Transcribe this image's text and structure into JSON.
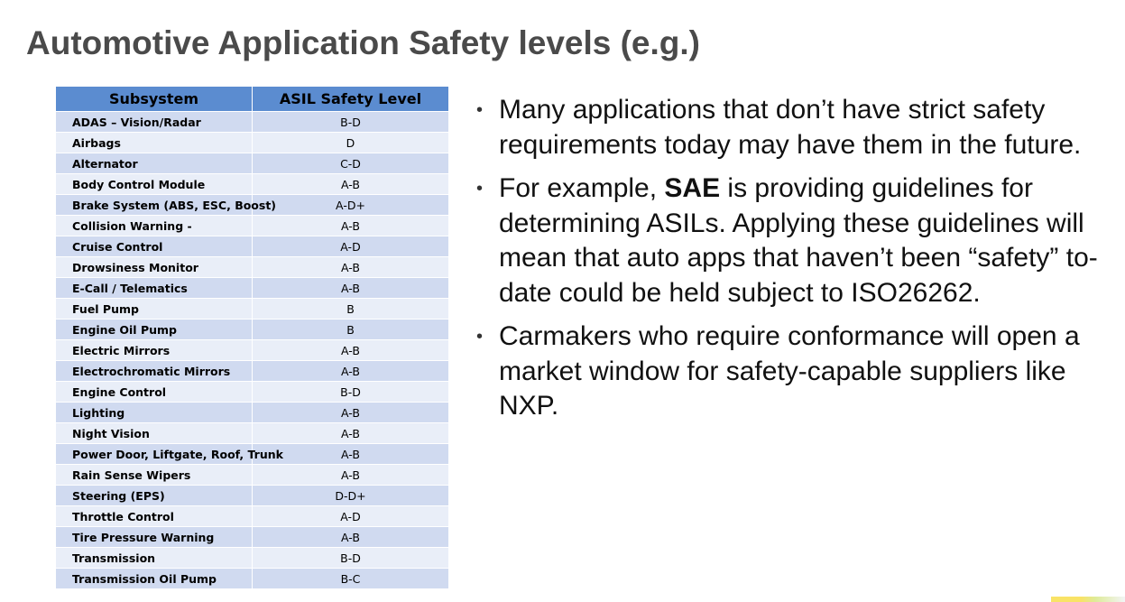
{
  "title": "Automotive Application Safety levels (e.g.)",
  "table": {
    "headers": {
      "subsystem": "Subsystem",
      "level": "ASIL Safety Level"
    },
    "rows": [
      {
        "subsystem": "ADAS – Vision/Radar",
        "level": "B-D"
      },
      {
        "subsystem": "Airbags",
        "level": "D"
      },
      {
        "subsystem": "Alternator",
        "level": "C-D"
      },
      {
        "subsystem": "Body Control Module",
        "level": "A-B"
      },
      {
        "subsystem": "Brake System (ABS, ESC, Boost)",
        "level": "A-D+"
      },
      {
        "subsystem": "Collision Warning -",
        "level": "A-B"
      },
      {
        "subsystem": "Cruise Control",
        "level": "A-D"
      },
      {
        "subsystem": "Drowsiness Monitor",
        "level": "A-B"
      },
      {
        "subsystem": "E-Call / Telematics",
        "level": "A-B"
      },
      {
        "subsystem": "Fuel Pump",
        "level": "B"
      },
      {
        "subsystem": "Engine Oil Pump",
        "level": "B"
      },
      {
        "subsystem": "Electric Mirrors",
        "level": "A-B"
      },
      {
        "subsystem": "Electrochromatic Mirrors",
        "level": "A-B"
      },
      {
        "subsystem": "Engine Control",
        "level": "B-D"
      },
      {
        "subsystem": "Lighting",
        "level": "A-B"
      },
      {
        "subsystem": "Night Vision",
        "level": "A-B"
      },
      {
        "subsystem": "Power Door, Liftgate, Roof, Trunk",
        "level": "A-B"
      },
      {
        "subsystem": "Rain Sense Wipers",
        "level": "A-B"
      },
      {
        "subsystem": "Steering (EPS)",
        "level": "D-D+"
      },
      {
        "subsystem": "Throttle Control",
        "level": "A-D"
      },
      {
        "subsystem": "Tire Pressure Warning",
        "level": "A-B"
      },
      {
        "subsystem": "Transmission",
        "level": "B-D"
      },
      {
        "subsystem": "Transmission Oil Pump",
        "level": "B-C"
      }
    ]
  },
  "bullets": [
    {
      "marker": "•",
      "text": "Many applications that don’t have strict safety requirements today may have them in the future."
    },
    {
      "marker": "•",
      "pre": "For example, ",
      "bold": "SAE",
      "post": " is providing guidelines for determining ASILs.  Applying these guidelines will mean that auto apps that haven’t been “safety” to-date could be held subject to ISO26262."
    },
    {
      "marker": "•",
      "text": "Carmakers who require conformance will open a market window for safety-capable suppliers like NXP."
    }
  ],
  "colors": {
    "header_fill": "#5b8cd0",
    "row_band_dark": "#d0daf0",
    "row_band_light": "#e9eef8",
    "title_text": "#4a4a4a"
  }
}
